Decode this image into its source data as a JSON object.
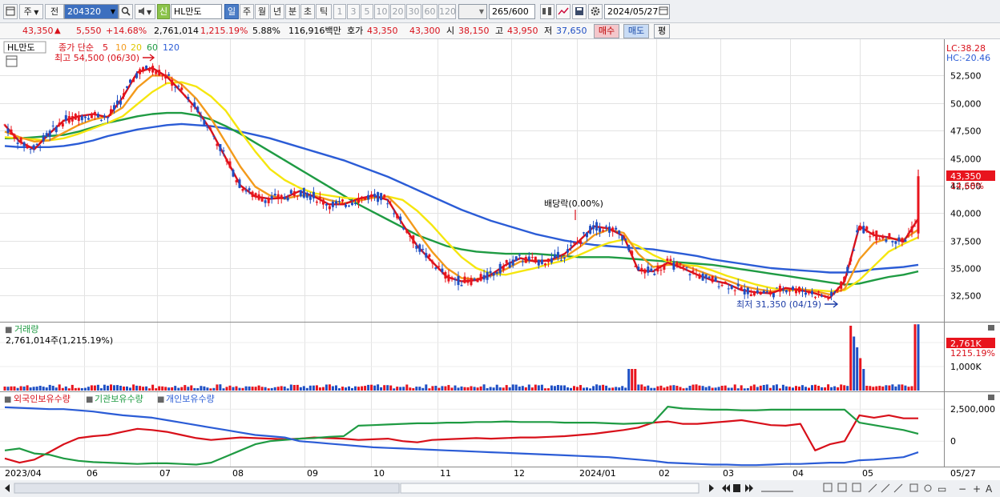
{
  "toolbar": {
    "period_select": "주",
    "market_select": "전",
    "stock_code": "204320",
    "credit_badge": "신",
    "stock_name": "HL만도",
    "tabs": [
      "일",
      "주",
      "월",
      "년",
      "분",
      "초",
      "틱"
    ],
    "active_tab": "일",
    "minute_options": [
      "1",
      "3",
      "5",
      "10",
      "20",
      "30",
      "60",
      "120"
    ],
    "count_value": "265",
    "count_max": "/600",
    "date_value": "2024/05/27"
  },
  "infobar": {
    "price": "43,350",
    "arrow": "▲",
    "change": "5,550",
    "change_pct": "+14.68%",
    "volume": "2,761,014",
    "volume_pct": "1,215.19%",
    "turnover_pct": "5.88%",
    "amount": "116,916백만",
    "ask_label": "호가",
    "ask1": "43,350",
    "ask2": "43,300",
    "open_label": "시",
    "open": "38,150",
    "high_label": "고",
    "high": "43,950",
    "low_label": "저",
    "low": "37,650",
    "buy_button": "매수",
    "sell_button": "매도",
    "avg_button": "평"
  },
  "price_panel": {
    "name_tag": "HL만도",
    "legend_prefix": "종가 단순",
    "ma_labels": [
      "5",
      "10",
      "20",
      "60",
      "120"
    ],
    "ma_colors": [
      "#d8101a",
      "#f39a1b",
      "#f5e60f",
      "#1f9b43",
      "#2b5cd6"
    ],
    "high_annotation": "최고 54,500 (06/30)",
    "low_annotation": "최저 31,350 (04/19)",
    "dividend_annotation": "배당락(0.00%)",
    "lc_label": "LC:38.28",
    "hc_label": "HC:-20.46",
    "current_price_tag": "43,350",
    "current_pct_tag": "14.68%"
  },
  "volume_panel": {
    "title": "거래량",
    "value_text": "2,761,014주(1,215.19%)",
    "current_tag": "2,761K",
    "current_pct_tag": "1215.19%"
  },
  "holding_panel": {
    "legend": [
      "외국인보유수량",
      "기관보유수량",
      "개인보유수량"
    ],
    "colors": [
      "#d8101a",
      "#1f9b43",
      "#2b5cd6"
    ],
    "axis_labels": [
      "2,500,000",
      "0"
    ]
  },
  "chart_data": {
    "type": "candlestick",
    "x_labels": [
      "2023/04",
      "06",
      "07",
      "08",
      "09",
      "10",
      "11",
      "12",
      "2024/01",
      "02",
      "03",
      "04",
      "05",
      "05/27"
    ],
    "price_axis": {
      "ticks": [
        52500,
        50000,
        47500,
        45000,
        42500,
        40000,
        37500,
        35000,
        32500
      ],
      "ylim": [
        30200,
        55800
      ]
    },
    "volume_axis": {
      "ticks": [
        "2,000K",
        "1,000K"
      ],
      "ylim": [
        0,
        2800000
      ]
    },
    "ma_series": [
      {
        "name": "5",
        "color": "#d8101a",
        "values": [
          48000,
          46500,
          45800,
          47200,
          48400,
          48800,
          49000,
          48700,
          50500,
          52800,
          53200,
          52400,
          51000,
          49500,
          47500,
          45000,
          42500,
          41500,
          41300,
          41400,
          42000,
          41500,
          40800,
          40800,
          41300,
          41600,
          41200,
          39000,
          37000,
          35600,
          34200,
          33800,
          33900,
          34400,
          35300,
          35900,
          35600,
          35700,
          36300,
          37500,
          38800,
          38600,
          37900,
          34800,
          34700,
          35500,
          35000,
          34400,
          33900,
          33600,
          33000,
          32800,
          32700,
          33200,
          33000,
          32700,
          32300,
          33800,
          38800,
          38000,
          37800,
          37400,
          39500
        ]
      },
      {
        "name": "10",
        "color": "#f39a1b",
        "values": [
          47400,
          46900,
          46500,
          46600,
          47300,
          48000,
          48500,
          48800,
          49600,
          51400,
          52500,
          52500,
          51700,
          50400,
          48600,
          46400,
          44200,
          42400,
          41600,
          41300,
          41600,
          41600,
          41200,
          40900,
          41100,
          41400,
          41500,
          40200,
          38300,
          36500,
          35000,
          34100,
          34000,
          34300,
          34900,
          35600,
          35700,
          35700,
          36000,
          36900,
          38000,
          38500,
          38200,
          36300,
          35100,
          35300,
          35300,
          34800,
          34300,
          33900,
          33400,
          33100,
          32900,
          33000,
          33100,
          32900,
          32600,
          33100,
          35800,
          37300,
          37700,
          37600,
          38500
        ]
      },
      {
        "name": "20",
        "color": "#f5e60f",
        "values": [
          46900,
          46800,
          46700,
          46600,
          46800,
          47200,
          47700,
          48200,
          48800,
          49900,
          51000,
          51800,
          51900,
          51500,
          50600,
          49300,
          47400,
          45600,
          44000,
          43000,
          42300,
          41800,
          41600,
          41400,
          41300,
          41400,
          41500,
          41200,
          40200,
          38900,
          37400,
          36000,
          35000,
          34500,
          34400,
          34700,
          35000,
          35400,
          35700,
          36200,
          36800,
          37300,
          37600,
          37000,
          36200,
          35600,
          35300,
          35200,
          34800,
          34300,
          33900,
          33500,
          33200,
          33000,
          33000,
          33000,
          32900,
          33000,
          33900,
          35200,
          36500,
          37200,
          37800
        ]
      },
      {
        "name": "60",
        "color": "#1f9b43",
        "values": [
          46800,
          46800,
          46900,
          47000,
          47100,
          47400,
          47800,
          48200,
          48500,
          48800,
          49000,
          49100,
          49100,
          48900,
          48500,
          47900,
          47200,
          46400,
          45600,
          44800,
          44000,
          43200,
          42400,
          41600,
          40800,
          40100,
          39400,
          38700,
          38000,
          37500,
          37000,
          36700,
          36500,
          36400,
          36300,
          36300,
          36300,
          36200,
          36100,
          36000,
          36000,
          36000,
          35900,
          35800,
          35700,
          35600,
          35500,
          35400,
          35300,
          35100,
          34900,
          34700,
          34500,
          34300,
          34100,
          33900,
          33700,
          33500,
          33600,
          33900,
          34200,
          34400,
          34700
        ]
      },
      {
        "name": "120",
        "color": "#2b5cd6",
        "values": [
          46100,
          46000,
          46000,
          46000,
          46100,
          46300,
          46600,
          47000,
          47300,
          47600,
          47800,
          48000,
          48100,
          48000,
          47900,
          47700,
          47400,
          47100,
          46800,
          46400,
          46000,
          45600,
          45200,
          44800,
          44300,
          43800,
          43300,
          42700,
          42100,
          41500,
          40900,
          40300,
          39800,
          39300,
          38900,
          38500,
          38100,
          37800,
          37500,
          37300,
          37100,
          37000,
          36900,
          36800,
          36700,
          36500,
          36300,
          36100,
          35800,
          35600,
          35400,
          35200,
          35000,
          34900,
          34800,
          34700,
          34600,
          34600,
          34700,
          34900,
          35000,
          35100,
          35300
        ]
      }
    ],
    "holding_series": [
      {
        "name": "외국인보유수량",
        "color": "#d8101a",
        "values": [
          0.12,
          0.05,
          0.1,
          0.22,
          0.35,
          0.45,
          0.48,
          0.5,
          0.55,
          0.6,
          0.58,
          0.55,
          0.5,
          0.45,
          0.42,
          0.44,
          0.46,
          0.45,
          0.44,
          0.43,
          0.44,
          0.46,
          0.45,
          0.44,
          0.42,
          0.43,
          0.44,
          0.4,
          0.38,
          0.42,
          0.43,
          0.44,
          0.45,
          0.44,
          0.45,
          0.46,
          0.46,
          0.47,
          0.48,
          0.5,
          0.52,
          0.55,
          0.58,
          0.62,
          0.7,
          0.72,
          0.68,
          0.68,
          0.7,
          0.72,
          0.74,
          0.7,
          0.66,
          0.65,
          0.68,
          0.25,
          0.35,
          0.4,
          0.82,
          0.78,
          0.82,
          0.77,
          0.77
        ]
      },
      {
        "name": "기관보유수량",
        "color": "#1f9b43",
        "values": [
          0.25,
          0.28,
          0.2,
          0.18,
          0.12,
          0.08,
          0.06,
          0.05,
          0.04,
          0.03,
          0.04,
          0.04,
          0.03,
          0.02,
          0.05,
          0.15,
          0.25,
          0.35,
          0.4,
          0.42,
          0.44,
          0.45,
          0.47,
          0.48,
          0.65,
          0.66,
          0.67,
          0.68,
          0.69,
          0.69,
          0.7,
          0.7,
          0.71,
          0.71,
          0.72,
          0.71,
          0.71,
          0.71,
          0.7,
          0.7,
          0.7,
          0.69,
          0.68,
          0.69,
          0.7,
          0.96,
          0.93,
          0.92,
          0.91,
          0.91,
          0.9,
          0.9,
          0.91,
          0.91,
          0.91,
          0.91,
          0.91,
          0.91,
          0.7,
          0.66,
          0.62,
          0.58,
          0.52
        ]
      },
      {
        "name": "개인보유수량",
        "color": "#2b5cd6",
        "values": [
          0.95,
          0.94,
          0.93,
          0.92,
          0.92,
          0.9,
          0.88,
          0.85,
          0.82,
          0.8,
          0.78,
          0.74,
          0.7,
          0.66,
          0.62,
          0.58,
          0.54,
          0.5,
          0.48,
          0.46,
          0.4,
          0.38,
          0.36,
          0.34,
          0.32,
          0.3,
          0.29,
          0.28,
          0.27,
          0.26,
          0.25,
          0.24,
          0.23,
          0.22,
          0.21,
          0.2,
          0.19,
          0.18,
          0.17,
          0.16,
          0.15,
          0.14,
          0.12,
          0.1,
          0.08,
          0.05,
          0.04,
          0.03,
          0.02,
          0.02,
          0.01,
          0.01,
          0.02,
          0.03,
          0.03,
          0.04,
          0.05,
          0.05,
          0.09,
          0.1,
          0.12,
          0.14,
          0.22
        ]
      }
    ]
  }
}
